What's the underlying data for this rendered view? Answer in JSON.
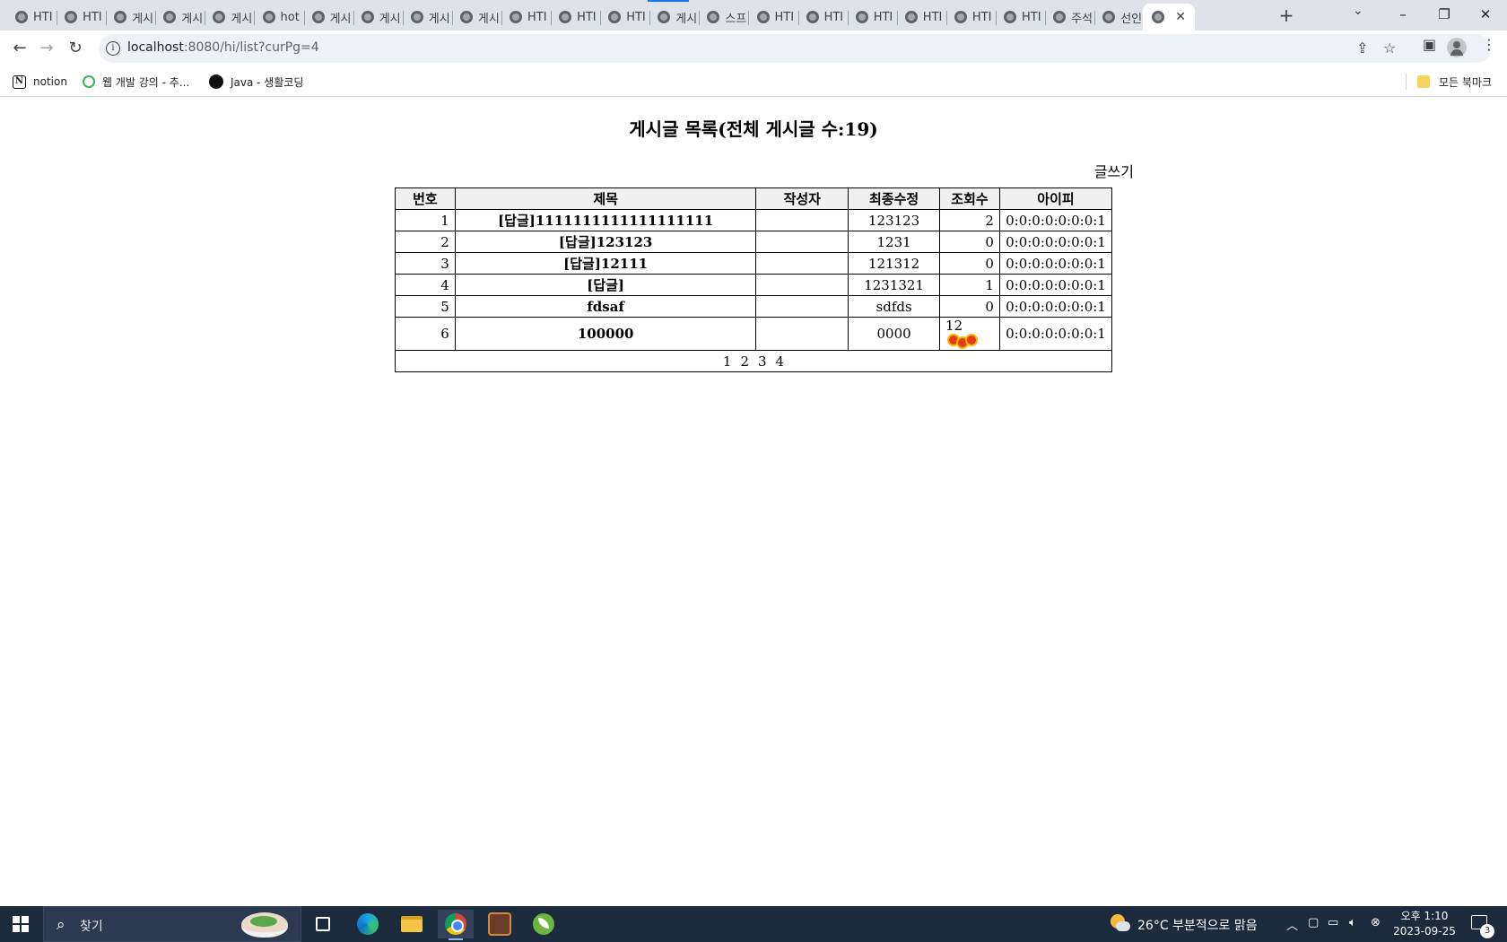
{
  "browser": {
    "tabs": [
      {
        "label": "HTI"
      },
      {
        "label": "HTI"
      },
      {
        "label": "게시"
      },
      {
        "label": "게시"
      },
      {
        "label": "게시"
      },
      {
        "label": "hot"
      },
      {
        "label": "게시"
      },
      {
        "label": "게시"
      },
      {
        "label": "게시"
      },
      {
        "label": "게시"
      },
      {
        "label": "HTI"
      },
      {
        "label": "HTI"
      },
      {
        "label": "HTI"
      },
      {
        "label": "게시"
      },
      {
        "label": "스프"
      },
      {
        "label": "HTI"
      },
      {
        "label": "HTI"
      },
      {
        "label": "HTI"
      },
      {
        "label": "HTI"
      },
      {
        "label": "HTI"
      },
      {
        "label": "HTI"
      },
      {
        "label": "주석"
      },
      {
        "label": "선인"
      },
      {
        "label": ""
      }
    ],
    "close_tab_glyph": "✕",
    "new_tab_glyph": "+",
    "url_host": "localhost",
    "url_rest": ":8080/hi/list?curPg=4",
    "bookmarks": [
      {
        "label": "notion",
        "icon": "notion-icon"
      },
      {
        "label": "웹 개발 강의 - 추...",
        "icon": "q-icon"
      },
      {
        "label": "Java - 생활코딩",
        "icon": "dot-icon"
      }
    ],
    "all_bookmarks": "모든 북마크"
  },
  "page": {
    "title": "게시글 목록(전체 게시글 수:19)",
    "write_link": "글쓰기",
    "columns": [
      "번호",
      "제목",
      "작성자",
      "최종수정",
      "조회수",
      "아이피"
    ],
    "rows": [
      {
        "num": "1",
        "title": "[답글]1111111111111111111",
        "writer": "",
        "modified": "123123",
        "hits": "2",
        "ip": "0:0:0:0:0:0:0:1",
        "hot": false
      },
      {
        "num": "2",
        "title": "[답글]123123",
        "writer": "",
        "modified": "1231",
        "hits": "0",
        "ip": "0:0:0:0:0:0:0:1",
        "hot": false
      },
      {
        "num": "3",
        "title": "[답글]12111",
        "writer": "",
        "modified": "121312",
        "hits": "0",
        "ip": "0:0:0:0:0:0:0:1",
        "hot": false
      },
      {
        "num": "4",
        "title": "[답글]",
        "writer": "",
        "modified": "1231321",
        "hits": "1",
        "ip": "0:0:0:0:0:0:0:1",
        "hot": false
      },
      {
        "num": "5",
        "title": "fdsaf",
        "writer": "",
        "modified": "sdfds",
        "hits": "0",
        "ip": "0:0:0:0:0:0:0:1",
        "hot": false
      },
      {
        "num": "6",
        "title": "100000",
        "writer": "",
        "modified": "0000",
        "hits": "12",
        "ip": "0:0:0:0:0:0:0:1",
        "hot": true
      }
    ],
    "pages": [
      "1",
      "2",
      "3",
      "4"
    ]
  },
  "taskbar": {
    "search_placeholder": "찾기",
    "weather": "26°C 부분적으로 맑음",
    "time": "오후 1:10",
    "date": "2023-09-25",
    "notifications": "3"
  },
  "colors": {
    "tab_strip": "#dfe3e8",
    "taskbar": "#1c2a3e",
    "accent": "#1a73e8",
    "hot_badge": "#e23b1b"
  }
}
